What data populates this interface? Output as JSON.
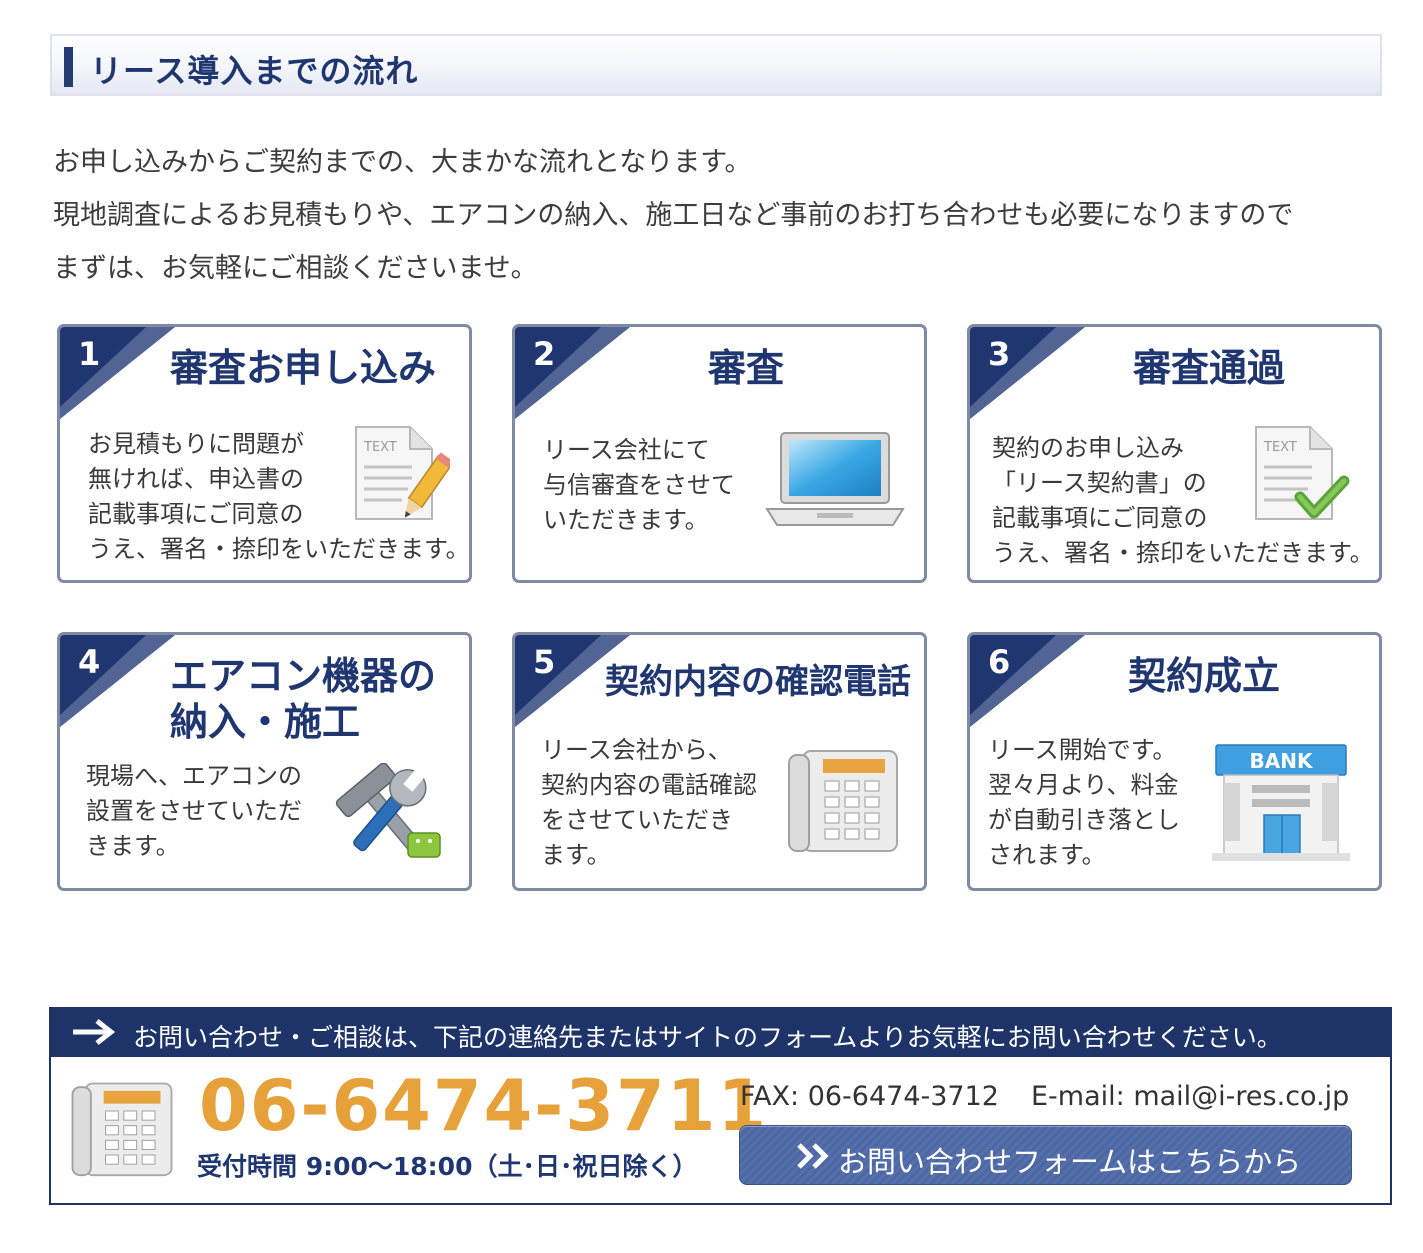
{
  "section": {
    "title": "リース導入までの流れ"
  },
  "intro": {
    "lines": [
      "お申し込みからご契約までの、大まかな流れとなります。",
      "現地調査によるお見積もりや、エアコンの納入、施工日など事前のお打ち合わせも必要になりますので",
      "まずは、お気軽にご相談くださいませ。"
    ]
  },
  "steps": [
    {
      "num": "1",
      "title": "審査お申し込み",
      "lines": [
        "お見積もりに問題が",
        "無ければ、申込書の",
        "記載事項にご同意の",
        "うえ、署名・捺印をいただきます。"
      ],
      "icon": "document-pencil-icon",
      "icon_text": "TEXT"
    },
    {
      "num": "2",
      "title": "審査",
      "lines": [
        "リース会社にて",
        "与信審査をさせて",
        "いただきます。"
      ],
      "icon": "laptop-icon"
    },
    {
      "num": "3",
      "title": "審査通過",
      "lines": [
        "契約のお申し込み",
        "「リース契約書」の",
        "記載事項にご同意の",
        "うえ、署名・捺印をいただきます。"
      ],
      "icon": "document-check-icon",
      "icon_text": "TEXT"
    },
    {
      "num": "4",
      "title_lines": [
        "エアコン機器の",
        "納入・施工"
      ],
      "lines": [
        "現場へ、エアコンの",
        "設置をさせていただ",
        "きます。"
      ],
      "icon": "tools-icon"
    },
    {
      "num": "5",
      "title": "契約内容の確認電話",
      "lines": [
        "リース会社から、",
        "契約内容の電話確認",
        "をさせていただき",
        "ます。"
      ],
      "icon": "telephone-icon"
    },
    {
      "num": "6",
      "title": "契約成立",
      "lines": [
        "リース開始です。",
        "翌々月より、料金",
        "が自動引き落とし",
        "されます。"
      ],
      "icon": "bank-icon",
      "icon_text": "BANK"
    }
  ],
  "contact": {
    "bar_text": "お問い合わせ・ご相談は、下記の連絡先またはサイトのフォームよりお気軽にお問い合わせください。",
    "phone": "06-6474-3711",
    "hours": "受付時間 9:00〜18:00（土･日･祝日除く）",
    "fax": "FAX: 06-6474-3712",
    "email": "E-mail: mail@i-res.co.jp",
    "form_button": "お問い合わせフォームはこちらから"
  },
  "colors": {
    "navy": "#1e3468",
    "title_blue": "#1f3670",
    "orange": "#e6a13b",
    "card_border": "#7f8aa3"
  }
}
